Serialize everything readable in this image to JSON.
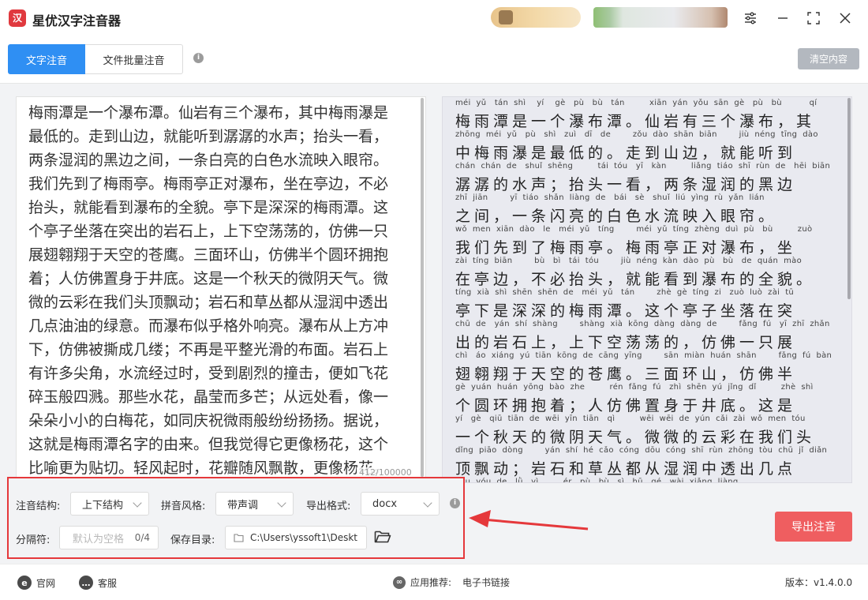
{
  "app": {
    "title": "星优汉字注音器",
    "logo_glyph": "汉"
  },
  "tabs": [
    {
      "label": "文字注音",
      "active": true
    },
    {
      "label": "文件批量注音",
      "active": false
    }
  ],
  "toolbar": {
    "clear_label": "清空内容"
  },
  "input_text": {
    "lines": [
      "梅雨潭是一个瀑布潭。仙岩有三个瀑布，其中梅雨瀑是",
      "最低的。走到山边，就能听到潺潺的水声；抬头一看，",
      "两条湿润的黑边之间，一条白亮的白色水流映入眼帘。",
      "我们先到了梅雨亭。梅雨亭正对瀑布，坐在亭边，不必",
      "抬头，就能看到瀑布的全貌。亭下是深深的梅雨潭。这",
      "个亭子坐落在突出的岩石上，上下空荡荡的，仿佛一只",
      "展翅翱翔于天空的苍鹰。三面环山，仿佛半个圆环拥抱",
      "着；人仿佛置身于井底。这是一个秋天的微阴天气。微",
      "微的云彩在我们头顶飘动；岩石和草丛都从湿润中透出",
      "几点油油的绿意。而瀑布似乎格外响亮。瀑布从上方冲",
      "下，仿佛被撕成几缕；不再是平整光滑的布面。岩石上",
      "有许多尖角，水流经过时，受到剧烈的撞击，便如飞花",
      "碎玉般四溅。那些水花，晶莹而多芒；从远处看，像一",
      "朵朵小小的白梅花，如同庆祝微雨般纷纷扬扬。据说，",
      "这就是梅雨潭名字的由来。但我觉得它更像杨花，这个",
      "比喻更为贴切。轻风起时，花瓣随风飘散，更像杨花。"
    ],
    "char_count": "412/100000"
  },
  "pinyin_output": [
    {
      "py": "méi  yǔ   tán  shì    yí    gè   pù   bù   tán         xiān  yán  yǒu  sān  gè   pù   bù          qí",
      "hz": "梅雨潭是一个瀑布潭。仙岩有三个瀑布，其"
    },
    {
      "py": "zhōng  méi  yǔ   pù   shì   zuì   dī   de        zǒu  dào  shān  biān        jiù  néng  tīng  dào",
      "hz": "中梅雨瀑是最低的。走到山边，就能听到"
    },
    {
      "py": "chán  chán  de   shuǐ  shēng         tái  tóu   yī   kàn         liǎng  tiáo  shī  rùn  de   hēi  biān",
      "hz": "潺潺的水声；抬头一看，两条湿润的黑边"
    },
    {
      "py": "zhī  jiān        yī  tiáo  shǎn  liàng  de   bái   sè   shuǐ  liú  yìng  rù  yǎn  lián",
      "hz": "之间，一条闪亮的白色水流映入眼帘。"
    },
    {
      "py": "wǒ  men  xiān  dào   le   méi  yǔ   tíng        méi  yǔ  tíng  zhèng  duì  pù   bù         zuò",
      "hz": "我们先到了梅雨亭。梅雨亭正对瀑布，坐"
    },
    {
      "py": "zài  tíng  biān        bù   bì   tái  tóu        jiù  néng  kàn  dào  pù   bù   de  quán  mào",
      "hz": "在亭边，不必抬头，就能看到瀑布的全貌。"
    },
    {
      "py": "tíng  xià  shì  shēn  shēn  de   méi  yǔ   tán        zhè  gè  tíng  zi   zuò  luò  zài  tū",
      "hz": "亭下是深深的梅雨潭。这个亭子坐落在突"
    },
    {
      "py": "chū  de   yán  shí  shàng        shàng  xià  kōng  dàng  dàng  de        fǎng  fú   yī  zhī  zhǎn",
      "hz": "出的岩石上，上下空荡荡的，仿佛一只展"
    },
    {
      "py": "chì   áo  xiáng  yú  tiān  kōng  de  cāng  yīng        sān  miàn  huán  shān        fǎng  fú  bàn",
      "hz": "翅翱翔于天空的苍鹰。三面环山，仿佛半"
    },
    {
      "py": "gè  yuán  huán  yōng  bào  zhe         rén  fǎng  fú   zhì  shēn  yú  jǐng  dǐ         zhè  shì",
      "hz": "个圆环拥抱着；人仿佛置身于井底。这是"
    },
    {
      "py": "yí   gè   qiū  tiān  de  wēi  yīn  tiān   qì         wēi  wēi  de  yún  cǎi  zài  wǒ  men  tóu",
      "hz": "一个秋天的微阴天气。微微的云彩在我们头"
    },
    {
      "py": "dǐng  piāo  dòng        yán  shí  hé  cǎo  cóng  dōu  cóng  shī  rùn  zhōng  tòu  chū  jǐ  diǎn",
      "hz": "顶飘动；岩石和草丛都从湿润中透出几点"
    },
    {
      "py": "yóu  yóu  de   lǜ   yì         ér   pù   bù   sì   hū   gé   wài  xiǎng  liàng",
      "hz": ""
    }
  ],
  "settings": {
    "structure_label": "注音结构:",
    "structure_value": "上下结构",
    "style_label": "拼音风格:",
    "style_value": "带声调",
    "format_label": "导出格式:",
    "format_value": "docx",
    "separator_label": "分隔符:",
    "separator_placeholder": "默认为空格",
    "separator_count": "0/4",
    "save_dir_label": "保存目录:",
    "save_dir_value": "C:\\Users\\yssoft1\\Deskt"
  },
  "actions": {
    "export_label": "导出注音"
  },
  "footer": {
    "website": "官网",
    "service": "客服",
    "recommend_label": "应用推荐:",
    "recommend_link": "电子书链接",
    "version": "版本：v1.4.0.0"
  },
  "colors": {
    "accent": "#2f8ff3",
    "export": "#ef5e60",
    "highlight": "#e5383b"
  }
}
